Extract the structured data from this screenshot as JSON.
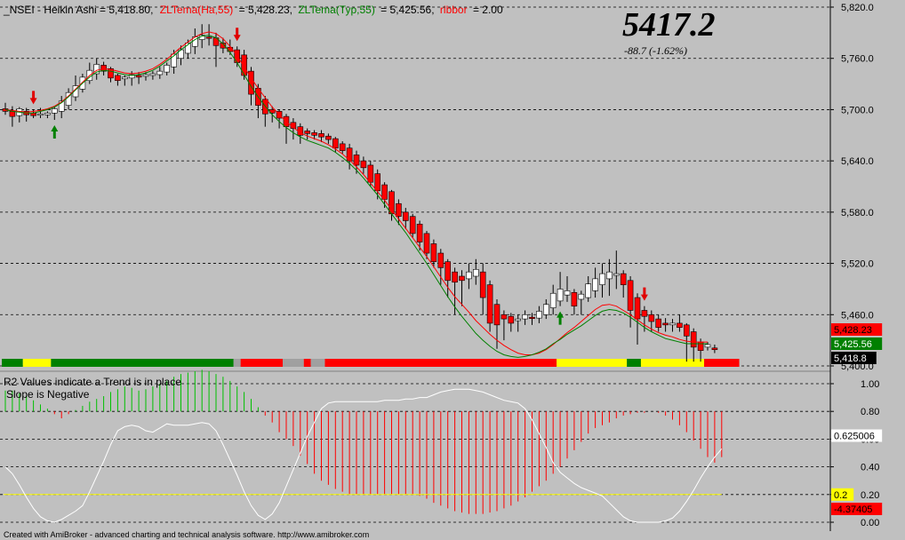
{
  "header": {
    "symbol_text": "_NSEI - Heikin Ashi  = 5,418.80,",
    "zl_ha_text": "ZLTema(Ha,55)",
    "zl_ha_value": "= 5,428.23,",
    "zl_typ_text": "ZLTema(Typ,55)",
    "zl_typ_value": "= 5,425.56,",
    "ribbon_text": "ribbor",
    "ribbon_value": "= 2.00"
  },
  "quote": {
    "price": "5417.2",
    "change": "-88.7  (-1.62%)"
  },
  "footer": "Created with AmiBroker - advanced charting and technical analysis software. http://www.amibroker.com",
  "colors": {
    "background": "#c0c0c0",
    "up": "#ffffff",
    "down": "#ff0000",
    "zl_ha": "#ff0000",
    "zl_typ": "#008000",
    "r2_up": "#00c000",
    "r2_down": "#ff0000",
    "threshold": "#ffff00",
    "ribbon_green": "#008000",
    "ribbon_yellow": "#ffff00",
    "ribbon_red": "#ff0000",
    "ribbon_grey": "#a0a0a0"
  },
  "chart_data": [
    {
      "type": "candlestick",
      "title": "_NSEI - Heikin Ashi",
      "y_ticks": [
        "5,820.0",
        "5,760.0",
        "5,700.0",
        "5,640.0",
        "5,580.0",
        "5,520.0",
        "5,460.0",
        "5,400.0"
      ],
      "ylim": [
        5400,
        5820
      ],
      "ohlc": [
        [
          5701,
          5708,
          5694,
          5698
        ],
        [
          5698,
          5704,
          5680,
          5692
        ],
        [
          5693,
          5703,
          5685,
          5701
        ],
        [
          5698,
          5702,
          5686,
          5694
        ],
        [
          5696,
          5700,
          5690,
          5693
        ],
        [
          5694,
          5702,
          5690,
          5695
        ],
        [
          5694,
          5698,
          5690,
          5696
        ],
        [
          5696,
          5704,
          5688,
          5701
        ],
        [
          5698,
          5716,
          5690,
          5710
        ],
        [
          5705,
          5725,
          5700,
          5720
        ],
        [
          5715,
          5740,
          5710,
          5728
        ],
        [
          5724,
          5742,
          5720,
          5738
        ],
        [
          5734,
          5755,
          5730,
          5746
        ],
        [
          5742,
          5760,
          5735,
          5753
        ],
        [
          5752,
          5756,
          5740,
          5745
        ],
        [
          5748,
          5750,
          5732,
          5737
        ],
        [
          5740,
          5742,
          5728,
          5734
        ],
        [
          5736,
          5740,
          5728,
          5738
        ],
        [
          5737,
          5745,
          5728,
          5741
        ],
        [
          5740,
          5744,
          5730,
          5738
        ],
        [
          5739,
          5744,
          5734,
          5741
        ],
        [
          5740,
          5745,
          5735,
          5742
        ],
        [
          5741,
          5750,
          5736,
          5745
        ],
        [
          5744,
          5755,
          5740,
          5752
        ],
        [
          5750,
          5770,
          5742,
          5765
        ],
        [
          5760,
          5775,
          5752,
          5770
        ],
        [
          5766,
          5782,
          5760,
          5778
        ],
        [
          5774,
          5795,
          5765,
          5785
        ],
        [
          5782,
          5800,
          5772,
          5787
        ],
        [
          5785,
          5800,
          5775,
          5784
        ],
        [
          5784,
          5790,
          5750,
          5775
        ],
        [
          5778,
          5784,
          5766,
          5772
        ],
        [
          5773,
          5782,
          5764,
          5768
        ],
        [
          5770,
          5774,
          5750,
          5755
        ],
        [
          5764,
          5770,
          5735,
          5740
        ],
        [
          5745,
          5750,
          5705,
          5718
        ],
        [
          5725,
          5730,
          5690,
          5705
        ],
        [
          5712,
          5716,
          5680,
          5695
        ],
        [
          5700,
          5704,
          5685,
          5696
        ],
        [
          5698,
          5700,
          5678,
          5690
        ],
        [
          5692,
          5695,
          5660,
          5680
        ],
        [
          5685,
          5690,
          5665,
          5678
        ],
        [
          5680,
          5684,
          5660,
          5670
        ],
        [
          5675,
          5678,
          5665,
          5672
        ],
        [
          5673,
          5676,
          5665,
          5670
        ],
        [
          5672,
          5676,
          5662,
          5668
        ],
        [
          5669,
          5672,
          5660,
          5665
        ],
        [
          5666,
          5668,
          5650,
          5655
        ],
        [
          5660,
          5663,
          5648,
          5652
        ],
        [
          5655,
          5660,
          5630,
          5640
        ],
        [
          5647,
          5652,
          5625,
          5635
        ],
        [
          5640,
          5645,
          5625,
          5632
        ],
        [
          5635,
          5640,
          5610,
          5615
        ],
        [
          5625,
          5630,
          5595,
          5605
        ],
        [
          5612,
          5615,
          5585,
          5595
        ],
        [
          5604,
          5606,
          5570,
          5578
        ],
        [
          5590,
          5595,
          5565,
          5575
        ],
        [
          5580,
          5585,
          5560,
          5570
        ],
        [
          5575,
          5578,
          5550,
          5555
        ],
        [
          5566,
          5570,
          5535,
          5545
        ],
        [
          5555,
          5558,
          5525,
          5532
        ],
        [
          5543,
          5548,
          5515,
          5522
        ],
        [
          5532,
          5537,
          5495,
          5515
        ],
        [
          5522,
          5525,
          5480,
          5500
        ],
        [
          5510,
          5515,
          5460,
          5498
        ],
        [
          5505,
          5512,
          5470,
          5500
        ],
        [
          5502,
          5520,
          5490,
          5510
        ],
        [
          5505,
          5525,
          5495,
          5513
        ],
        [
          5510,
          5520,
          5460,
          5480
        ],
        [
          5495,
          5500,
          5440,
          5450
        ],
        [
          5472,
          5478,
          5420,
          5448
        ],
        [
          5460,
          5465,
          5430,
          5455
        ],
        [
          5458,
          5462,
          5440,
          5450
        ],
        [
          5453,
          5460,
          5440,
          5455
        ],
        [
          5455,
          5465,
          5448,
          5460
        ],
        [
          5457,
          5462,
          5448,
          5456
        ],
        [
          5456,
          5470,
          5450,
          5464
        ],
        [
          5460,
          5478,
          5455,
          5472
        ],
        [
          5468,
          5495,
          5460,
          5485
        ],
        [
          5476,
          5510,
          5470,
          5490
        ],
        [
          5483,
          5505,
          5475,
          5488
        ],
        [
          5486,
          5490,
          5460,
          5470
        ],
        [
          5478,
          5488,
          5460,
          5484
        ],
        [
          5480,
          5505,
          5475,
          5496
        ],
        [
          5488,
          5515,
          5480,
          5502
        ],
        [
          5495,
          5520,
          5480,
          5508
        ],
        [
          5502,
          5525,
          5482,
          5510
        ],
        [
          5506,
          5535,
          5490,
          5508
        ],
        [
          5508,
          5512,
          5480,
          5495
        ],
        [
          5500,
          5505,
          5445,
          5465
        ],
        [
          5480,
          5485,
          5425,
          5455
        ],
        [
          5465,
          5470,
          5440,
          5458
        ],
        [
          5460,
          5465,
          5440,
          5452
        ],
        [
          5455,
          5460,
          5440,
          5445
        ],
        [
          5450,
          5456,
          5440,
          5448
        ],
        [
          5448,
          5455,
          5440,
          5450
        ],
        [
          5450,
          5460,
          5440,
          5445
        ],
        [
          5448,
          5450,
          5405,
          5435
        ],
        [
          5440,
          5444,
          5405,
          5422
        ],
        [
          5428,
          5432,
          5405,
          5418
        ],
        [
          5422,
          5428,
          5418,
          5425
        ],
        [
          5421,
          5425,
          5415,
          5419
        ]
      ],
      "zl_ha": [
        5700,
        5699,
        5698,
        5697,
        5698,
        5699,
        5701,
        5704,
        5709,
        5716,
        5724,
        5732,
        5740,
        5746,
        5748,
        5747,
        5745,
        5743,
        5742,
        5743,
        5745,
        5748,
        5753,
        5759,
        5766,
        5773,
        5779,
        5785,
        5789,
        5791,
        5789,
        5783,
        5774,
        5763,
        5750,
        5737,
        5725,
        5714,
        5703,
        5694,
        5686,
        5679,
        5673,
        5669,
        5666,
        5663,
        5659,
        5654,
        5648,
        5641,
        5633,
        5624,
        5614,
        5604,
        5594,
        5583,
        5572,
        5561,
        5550,
        5539,
        5528,
        5516,
        5504,
        5492,
        5481,
        5472,
        5463,
        5453,
        5445,
        5437,
        5430,
        5424,
        5419,
        5415,
        5413,
        5413,
        5415,
        5419,
        5425,
        5432,
        5439,
        5445,
        5452,
        5459,
        5466,
        5471,
        5472,
        5470,
        5465,
        5460,
        5454,
        5448,
        5443,
        5439,
        5436,
        5434,
        5431,
        5429,
        5428,
        5428,
        5428
      ],
      "zl_typ": [
        5700,
        5698,
        5697,
        5696,
        5696,
        5698,
        5700,
        5703,
        5708,
        5715,
        5723,
        5731,
        5738,
        5744,
        5746,
        5745,
        5743,
        5741,
        5740,
        5741,
        5743,
        5746,
        5751,
        5757,
        5763,
        5770,
        5776,
        5782,
        5786,
        5787,
        5784,
        5777,
        5767,
        5755,
        5741,
        5727,
        5715,
        5704,
        5694,
        5686,
        5679,
        5673,
        5668,
        5664,
        5661,
        5658,
        5655,
        5650,
        5644,
        5637,
        5629,
        5620,
        5610,
        5600,
        5589,
        5578,
        5567,
        5556,
        5544,
        5532,
        5520,
        5507,
        5494,
        5481,
        5469,
        5458,
        5448,
        5438,
        5430,
        5423,
        5417,
        5413,
        5411,
        5410,
        5411,
        5413,
        5416,
        5420,
        5426,
        5431,
        5437,
        5442,
        5447,
        5453,
        5459,
        5464,
        5466,
        5465,
        5462,
        5457,
        5451,
        5445,
        5440,
        5436,
        5432,
        5430,
        5428,
        5426,
        5426,
        5426,
        5426
      ],
      "signals": [
        {
          "bar": 4,
          "dir": "sell"
        },
        {
          "bar": 7,
          "dir": "buy"
        },
        {
          "bar": 33,
          "dir": "sell"
        },
        {
          "bar": 79,
          "dir": "buy"
        },
        {
          "bar": 91,
          "dir": "sell"
        }
      ],
      "ribbon": [
        [
          "green",
          0,
          3
        ],
        [
          "yellow",
          3,
          7
        ],
        [
          "green",
          7,
          33
        ],
        [
          "grey",
          33,
          34
        ],
        [
          "red",
          34,
          40
        ],
        [
          "grey",
          40,
          43
        ],
        [
          "red",
          43,
          44
        ],
        [
          "grey",
          44,
          46
        ],
        [
          "red",
          46,
          79
        ],
        [
          "yellow",
          79,
          89
        ],
        [
          "green",
          89,
          91
        ],
        [
          "yellow",
          91,
          100
        ],
        [
          "red",
          100,
          105
        ]
      ],
      "value_labels": [
        {
          "text": "5,428.23",
          "value": 5428.23,
          "color": "red"
        },
        {
          "text": "5,425.56",
          "value": 5425.56,
          "color": "green"
        },
        {
          "text": "5,418.8",
          "value": 5418.8,
          "color": "black"
        }
      ]
    },
    {
      "type": "bar",
      "title": "R2 Values indicate a Trend is in place",
      "subtitle": "Slope is Negative",
      "y_ticks": [
        "1.00",
        "0.80",
        "0.60",
        "0.40",
        "0.20",
        "0.00"
      ],
      "ylim": [
        0,
        1
      ],
      "r2_bars": [
        0.15,
        0.15,
        0.13,
        0.11,
        0.08,
        0.05,
        0.02,
        -0.02,
        -0.05,
        -0.02,
        0.01,
        0.04,
        0.07,
        0.09,
        0.11,
        0.14,
        0.16,
        0.18,
        0.17,
        0.15,
        0.16,
        0.18,
        0.2,
        0.22,
        0.25,
        0.27,
        0.28,
        0.29,
        0.3,
        0.29,
        0.27,
        0.25,
        0.22,
        0.18,
        0.14,
        0.09,
        0.03,
        -0.03,
        -0.08,
        -0.15,
        -0.2,
        -0.25,
        -0.32,
        -0.38,
        -0.45,
        -0.5,
        -0.53,
        -0.56,
        -0.58,
        -0.6,
        -0.6,
        -0.6,
        -0.6,
        -0.6,
        -0.6,
        -0.6,
        -0.6,
        -0.6,
        -0.6,
        -0.61,
        -0.63,
        -0.66,
        -0.68,
        -0.7,
        -0.72,
        -0.73,
        -0.74,
        -0.74,
        -0.74,
        -0.73,
        -0.72,
        -0.7,
        -0.68,
        -0.65,
        -0.62,
        -0.58,
        -0.54,
        -0.5,
        -0.45,
        -0.4,
        -0.34,
        -0.28,
        -0.22,
        -0.16,
        -0.12,
        -0.1,
        -0.08,
        -0.05,
        -0.03,
        -0.02,
        -0.01,
        -0.01,
        0.0,
        -0.01,
        -0.03,
        -0.06,
        -0.1,
        -0.15,
        -0.21,
        -0.27,
        -0.33,
        -0.37,
        -0.33
      ],
      "r2_line": [
        0.4,
        0.35,
        0.27,
        0.18,
        0.1,
        0.04,
        0.01,
        0.0,
        0.02,
        0.05,
        0.08,
        0.12,
        0.22,
        0.33,
        0.44,
        0.56,
        0.66,
        0.69,
        0.7,
        0.69,
        0.66,
        0.65,
        0.68,
        0.71,
        0.7,
        0.7,
        0.7,
        0.71,
        0.72,
        0.71,
        0.66,
        0.56,
        0.45,
        0.34,
        0.22,
        0.12,
        0.05,
        0.02,
        0.06,
        0.14,
        0.26,
        0.38,
        0.5,
        0.62,
        0.72,
        0.82,
        0.86,
        0.87,
        0.87,
        0.87,
        0.87,
        0.87,
        0.87,
        0.87,
        0.88,
        0.88,
        0.88,
        0.89,
        0.89,
        0.9,
        0.9,
        0.92,
        0.94,
        0.95,
        0.96,
        0.96,
        0.96,
        0.95,
        0.94,
        0.92,
        0.9,
        0.88,
        0.87,
        0.86,
        0.82,
        0.74,
        0.64,
        0.54,
        0.43,
        0.36,
        0.32,
        0.28,
        0.25,
        0.23,
        0.21,
        0.19,
        0.14,
        0.09,
        0.04,
        0.01,
        0.0,
        0.0,
        0.0,
        0.0,
        0.01,
        0.03,
        0.08,
        0.15,
        0.23,
        0.32,
        0.4,
        0.47,
        0.53
      ],
      "threshold": 0.2,
      "value_labels": [
        {
          "text": "0.625006",
          "value": 0.625,
          "color": "white"
        },
        {
          "text": "0.2",
          "value": 0.2,
          "color": "yellow"
        },
        {
          "text": "-4.37405",
          "value": 0.02,
          "color": "red"
        }
      ]
    }
  ]
}
